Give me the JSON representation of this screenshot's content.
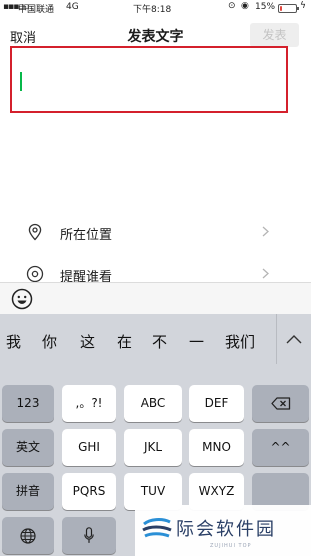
{
  "status_bar": {
    "carrier": "中国联通",
    "network": "4G",
    "time": "下午8:18",
    "battery_percent": "15%",
    "battery_level": 0.15
  },
  "nav": {
    "cancel_label": "取消",
    "title": "发表文字",
    "publish_label": "发表"
  },
  "compose": {
    "value": "",
    "highlight_color": "#d4202c",
    "caret_color": "#07b84a"
  },
  "options": [
    {
      "label": "所在位置",
      "icon": "location-pin-icon"
    },
    {
      "label": "提醒谁看",
      "icon": "at-icon"
    }
  ],
  "keyboard": {
    "candidates": [
      "我",
      "你",
      "这",
      "在",
      "不",
      "一",
      "我们"
    ],
    "rows": [
      [
        "123",
        ",。?!",
        "ABC",
        "DEF",
        "delete-icon"
      ],
      [
        "英文",
        "GHI",
        "JKL",
        "MNO",
        "^^"
      ],
      [
        "拼音",
        "PQRS",
        "TUV",
        "WXYZ"
      ],
      [
        "globe-icon",
        "mic-icon"
      ]
    ]
  },
  "watermark": {
    "name": "际会软件园",
    "subtitle": "ZUJIHUI TOP"
  }
}
